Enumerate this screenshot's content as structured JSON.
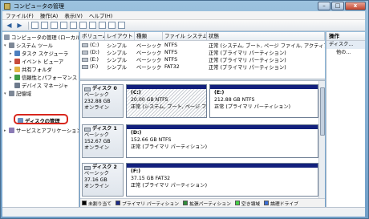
{
  "window": {
    "title": "コンピュータの管理",
    "buttons": {
      "minimize": "–",
      "maximize": "□",
      "close": "x"
    }
  },
  "menu": [
    "ファイル(F)",
    "操作(A)",
    "表示(V)",
    "ヘルプ(H)"
  ],
  "toolbar": {
    "back": "◀",
    "forward": "▶"
  },
  "tree": [
    {
      "label": "コンピュータの管理 (ローカル)",
      "color": "#8a96a8",
      "expander": ""
    },
    {
      "label": "システム ツール",
      "color": "#7d8796",
      "expander": "▾"
    },
    {
      "label": "タスク スケジューラ",
      "color": "#4c7fbf",
      "expander": "▸"
    },
    {
      "label": "イベント ビューア",
      "color": "#c84b3b",
      "expander": "▸"
    },
    {
      "label": "共有フォルダ",
      "color": "#e0b545",
      "expander": "▸"
    },
    {
      "label": "信頼性とパフォーマンス",
      "color": "#3f9b45",
      "expander": "▸"
    },
    {
      "label": "デバイス マネージャ",
      "color": "#6d7a8c",
      "expander": ""
    },
    {
      "label": "記憶域",
      "color": "#7d8796",
      "expander": "▾"
    },
    {
      "label": "ディスクの管理",
      "color": "#6a8fbf",
      "expander": ""
    },
    {
      "label": "サービスとアプリケーション",
      "color": "#8b7bb5",
      "expander": "▸"
    }
  ],
  "volume_list": {
    "headers": [
      "ボリューム",
      "レイアウト",
      "種類",
      "ファイル システム",
      "状態"
    ],
    "rows": [
      [
        "(C:)",
        "シンプル",
        "ベーシック",
        "NTFS",
        "正常 (システム, ブート, ページ ファイル, アクティブ"
      ],
      [
        "(D:)",
        "シンプル",
        "ベーシック",
        "NTFS",
        "正常 (プライマリ パーティション)"
      ],
      [
        "(E:)",
        "シンプル",
        "ベーシック",
        "NTFS",
        "正常 (プライマリ パーティション)"
      ],
      [
        "(F:)",
        "シンプル",
        "ベーシック",
        "FAT32",
        "正常 (プライマリ パーティション)"
      ]
    ]
  },
  "disks": [
    {
      "name": "ディスク 0",
      "type": "ベーシック",
      "size": "232.88 GB",
      "status": "オンライン",
      "partitions": [
        {
          "drive": "(C:)",
          "size": "20.00 GB NTFS",
          "status": "正常 (システム, ブート, ページ ファイル",
          "hatched": true
        },
        {
          "drive": "(E:)",
          "size": "212.88 GB NTFS",
          "status": "正常 (プライマリ パーティション)",
          "hatched": false
        }
      ]
    },
    {
      "name": "ディスク 1",
      "type": "ベーシック",
      "size": "152.67 GB",
      "status": "オンライン",
      "partitions": [
        {
          "drive": "(D:)",
          "size": "152.66 GB NTFS",
          "status": "正常 (プライマリ パーティション)",
          "hatched": false
        }
      ]
    },
    {
      "name": "ディスク 2",
      "type": "ベーシック",
      "size": "37.16 GB",
      "status": "オンライン",
      "partitions": [
        {
          "drive": "(F:)",
          "size": "37.15 GB FAT32",
          "status": "正常 (プライマリ パーティション)",
          "hatched": false
        }
      ]
    }
  ],
  "legend": [
    {
      "label": "未割り当て",
      "color": "#000000"
    },
    {
      "label": "プライマリ パーティション",
      "color": "#1a2a8c"
    },
    {
      "label": "拡張パーティション",
      "color": "#2f8f3a"
    },
    {
      "label": "空き領域",
      "color": "#44d244"
    },
    {
      "label": "論理ドライブ",
      "color": "#3a6fd8"
    }
  ],
  "actions": {
    "header": "操作",
    "section": "ディスク...",
    "item": "他の..."
  }
}
